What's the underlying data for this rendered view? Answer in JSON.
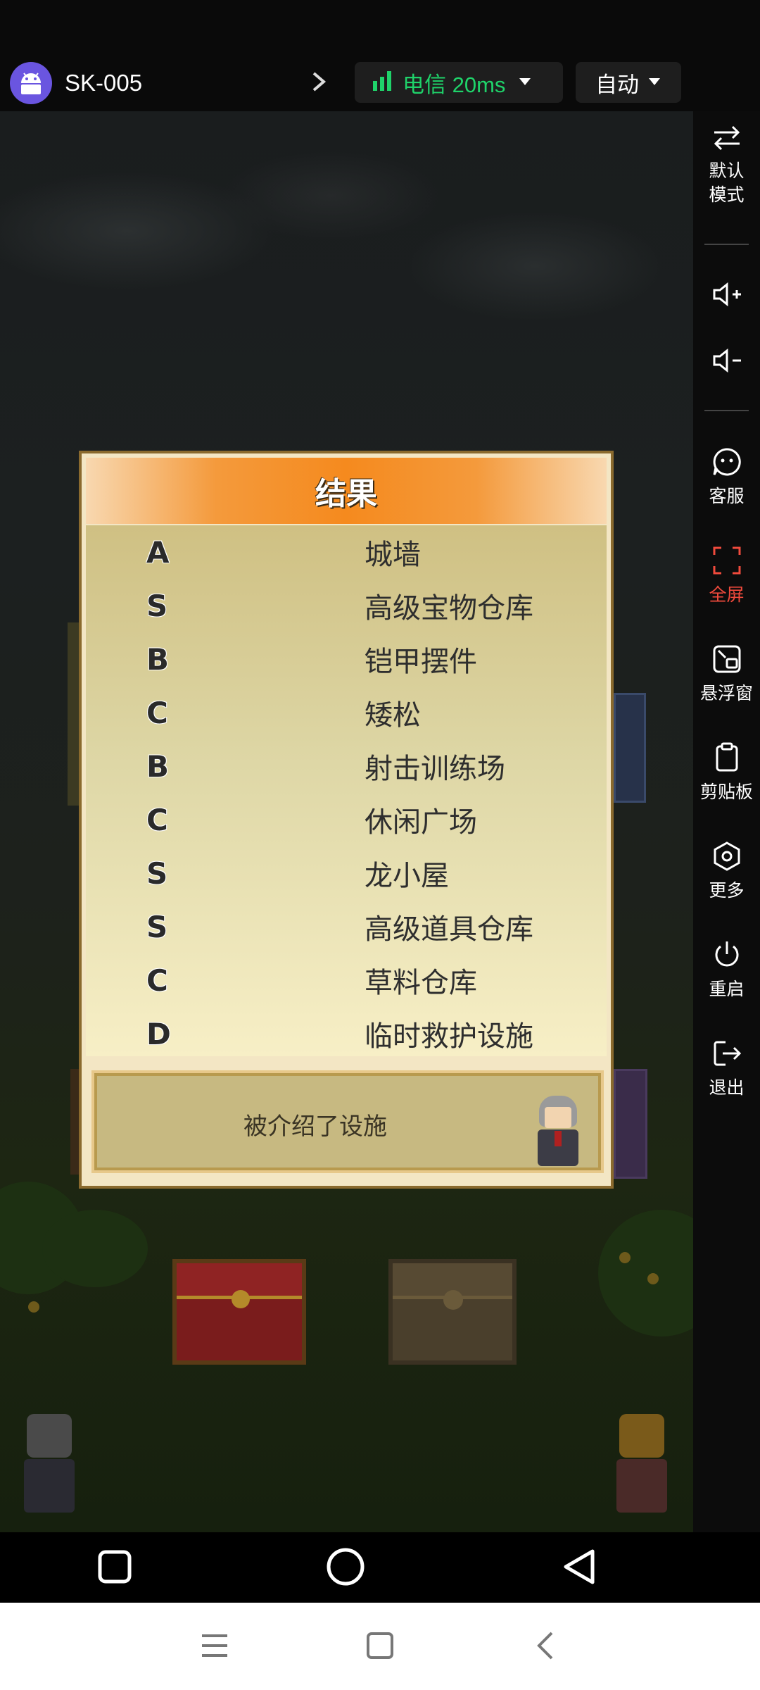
{
  "header": {
    "device_name": "SK-005",
    "network_label": "电信 20ms",
    "quality_label": "自动",
    "accent_green": "#1fd36a"
  },
  "dialog": {
    "title": "结果",
    "rows": [
      {
        "grade": "A",
        "facility": "城墙"
      },
      {
        "grade": "S",
        "facility": "高级宝物仓库"
      },
      {
        "grade": "B",
        "facility": "铠甲摆件"
      },
      {
        "grade": "C",
        "facility": "矮松"
      },
      {
        "grade": "B",
        "facility": "射击训练场"
      },
      {
        "grade": "C",
        "facility": "休闲广场"
      },
      {
        "grade": "S",
        "facility": "龙小屋"
      },
      {
        "grade": "S",
        "facility": "高级道具仓库"
      },
      {
        "grade": "C",
        "facility": "草料仓库"
      },
      {
        "grade": "D",
        "facility": "临时救护设施"
      }
    ],
    "footer_text": "被介绍了设施"
  },
  "side_panel": {
    "mode_label": "默认\n模式",
    "service_label": "客服",
    "fullscreen_label": "全屏",
    "float_label": "悬浮窗",
    "clipboard_label": "剪贴板",
    "more_label": "更多",
    "restart_label": "重启",
    "exit_label": "退出",
    "active_color": "#f04a3c"
  }
}
